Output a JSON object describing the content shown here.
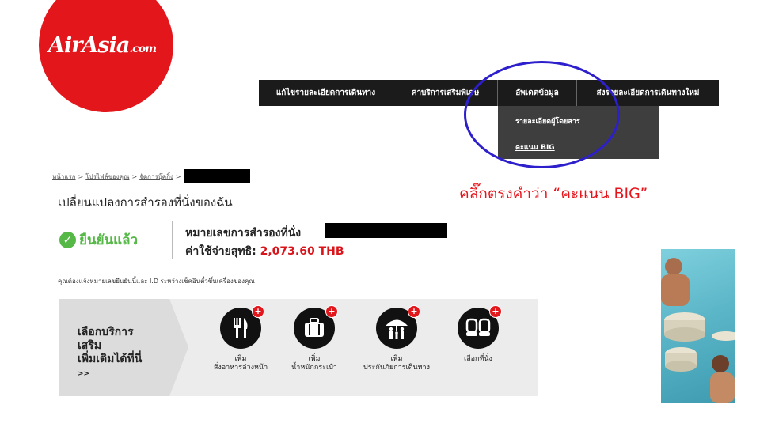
{
  "logo": {
    "text": "AirAsia",
    "suffix": ".com"
  },
  "nav": {
    "items": [
      "แก้ไขรายละเอียดการเดินทาง",
      "ค่าบริการเสริมพิเศษ",
      "อัพเดตข้อมูล",
      "ส่งรายละเอียดการเดินทางใหม่"
    ]
  },
  "dropdown": {
    "items": [
      "รายละเอียดผู้โดยสาร",
      "คะแนน BIG"
    ]
  },
  "annotation": {
    "text": "คลิ๊กตรงคำว่า “คะแนน BIG”"
  },
  "breadcrumb": {
    "items": [
      "หน้าแรก",
      "โปรไฟล์ของคุณ",
      "จัดการบุ๊คกิ้ง"
    ],
    "sep": ">"
  },
  "page": {
    "title": "เปลี่ยนแปลงการสำรองที่นั่งของฉัน",
    "status": "ยืนยันแล้ว",
    "booking_label": "หมายเลขการสำรองที่นั่ง",
    "cost_label": "ค่าใช้จ่ายสุทธิ:",
    "cost_value": "2,073.60 THB",
    "note": "คุณต้องแจ้งหมายเลขยืนยันนี้และ I.D ระหว่างเช็คอินตั๋วขึ้นเครื่องของคุณ"
  },
  "services": {
    "heading_lines": [
      "เลือกบริการ",
      "เสริม",
      "เพิ่มเติมได้ที่นี่"
    ],
    "more": ">>",
    "items": [
      {
        "line1": "เพิ่ม",
        "line2": "สั่งอาหารล่วงหน้า",
        "icon": "meal-icon"
      },
      {
        "line1": "เพิ่ม",
        "line2": "น้ำหนักกระเป๋า",
        "icon": "baggage-icon"
      },
      {
        "line1": "เพิ่ม",
        "line2": "ประกันภัยการเดินทาง",
        "icon": "insurance-icon"
      },
      {
        "line1": "",
        "line2": "เลือกที่นั่ง",
        "icon": "seat-icon"
      }
    ]
  },
  "colors": {
    "brand_red": "#e3161b",
    "confirm_green": "#56b947",
    "annotation_red": "#e8141b",
    "circle_blue": "#2d1fcb"
  }
}
